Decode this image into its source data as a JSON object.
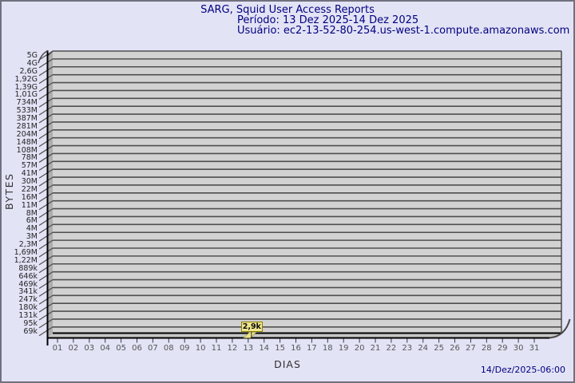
{
  "title": {
    "line1": "SARG, Squid User Access Reports",
    "line2": "Período: 13 Dez 2025-14 Dez 2025",
    "line3": "Usuário: ec2-13-52-80-254.us-west-1.compute.amazonaws.com"
  },
  "footer": {
    "timestamp": "14/Dez/2025-06:00"
  },
  "chart_data": {
    "type": "bar",
    "title": "SARG, Squid User Access Reports",
    "xlabel": "DIAS",
    "ylabel": "BYTES",
    "y_scale": "log",
    "grid": true,
    "legend": false,
    "y_tick_labels": [
      "5G",
      "4G",
      "2,6G",
      "1,92G",
      "1,39G",
      "1,01G",
      "734M",
      "533M",
      "387M",
      "281M",
      "204M",
      "148M",
      "108M",
      "78M",
      "57M",
      "41M",
      "30M",
      "22M",
      "16M",
      "11M",
      "8M",
      "6M",
      "4M",
      "3M",
      "2,3M",
      "1,69M",
      "1,22M",
      "889k",
      "646k",
      "469k",
      "341k",
      "247k",
      "180k",
      "131k",
      "95k",
      "69k"
    ],
    "x_tick_labels": [
      "01",
      "02",
      "03",
      "04",
      "05",
      "06",
      "07",
      "08",
      "09",
      "10",
      "11",
      "12",
      "13",
      "14",
      "15",
      "16",
      "17",
      "18",
      "19",
      "20",
      "21",
      "22",
      "23",
      "24",
      "25",
      "26",
      "27",
      "28",
      "29",
      "30",
      "31"
    ],
    "bars": [
      {
        "x": "13",
        "value_label": "2,9k",
        "bytes": 2900
      }
    ],
    "colors": {
      "page_bg": "#E3E3F6",
      "page_border": "#70707E",
      "title_text": "#000080",
      "plot_bg": "#D2D2D2",
      "wall_bg": "#ADADAD",
      "floor_bg": "#C6C6C6",
      "gridline": "#4F4F4F",
      "axis_line": "#000000",
      "bar_fill": "#EFE189",
      "value_box_bg": "#F0E68C",
      "value_box_border": "#8B8000"
    }
  }
}
